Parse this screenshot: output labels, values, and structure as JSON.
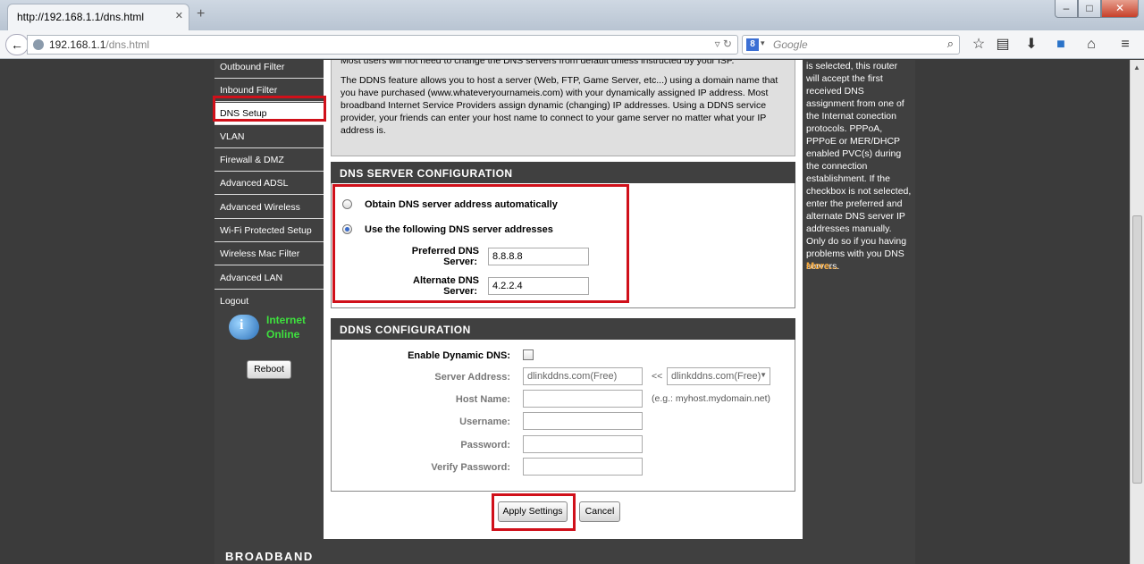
{
  "browser": {
    "tab_title": "http://192.168.1.1/dns.html",
    "new_tab": "+",
    "url_host": "192.168.1.1",
    "url_path": "/dns.html",
    "search_placeholder": "Google",
    "window_buttons": [
      "–",
      "□",
      "✕"
    ]
  },
  "sidebar": {
    "items": [
      {
        "label": "Outbound Filter"
      },
      {
        "label": "Inbound Filter"
      },
      {
        "label": "DNS Setup",
        "active": true
      },
      {
        "label": "VLAN"
      },
      {
        "label": "Firewall & DMZ"
      },
      {
        "label": "Advanced ADSL"
      },
      {
        "label": "Advanced Wireless"
      },
      {
        "label": "Wi-Fi Protected Setup"
      },
      {
        "label": "Wireless Mac Filter"
      },
      {
        "label": "Advanced LAN"
      },
      {
        "label": "Logout"
      }
    ],
    "status_line1": "Internet",
    "status_line2": "Online",
    "reboot_label": "Reboot"
  },
  "info": {
    "para1": "Most users will not need to change the DNS servers from default unless instructed by your ISP.",
    "para2": "The DDNS feature allows you to host a server (Web, FTP, Game Server, etc...) using a domain name that you have purchased (www.whateveryournameis.com) with your dynamically assigned IP address. Most broadband Internet Service Providers assign dynamic (changing) IP addresses. Using a DDNS service provider, your friends can enter your host name to connect to your game server no matter what your IP address is."
  },
  "dns": {
    "header": "DNS SERVER CONFIGURATION",
    "auto_label": "Obtain DNS server address automatically",
    "manual_label": "Use the following DNS server addresses",
    "selected": "manual",
    "preferred_label_1": "Preferred DNS",
    "preferred_label_2": "Server:",
    "preferred_value": "8.8.8.8",
    "alternate_label_1": "Alternate DNS",
    "alternate_label_2": "Server:",
    "alternate_value": "4.2.2.4"
  },
  "ddns": {
    "header": "DDNS CONFIGURATION",
    "enable_label": "Enable Dynamic DNS:",
    "enabled": false,
    "server_label": "Server Address:",
    "server_value": "dlinkddns.com(Free)",
    "server_sep": "<<",
    "server_select": "dlinkddns.com(Free)",
    "host_label": "Host Name:",
    "host_hint": "(e.g.: myhost.mydomain.net)",
    "user_label": "Username:",
    "pass_label": "Password:",
    "verify_label": "Verify Password:"
  },
  "actions": {
    "apply_label": "Apply Settings",
    "cancel_label": "Cancel"
  },
  "help": {
    "text": "is selected, this router will accept the first received DNS assignment from one of the Internat conection protocols. PPPoA, PPPoE or MER/DHCP enabled PVC(s) during the connection establishment. If the checkbox is not selected, enter the preferred and alternate DNS server IP addresses manually. Only do so if you having problems with you DNS servers.",
    "more_label": "More..."
  },
  "footer": {
    "brand": "BROADBAND"
  },
  "colors": {
    "highlight": "#d0101a",
    "panel_dark": "#404040",
    "status_green": "#3ee03e",
    "more_orange": "#f1a53a"
  }
}
